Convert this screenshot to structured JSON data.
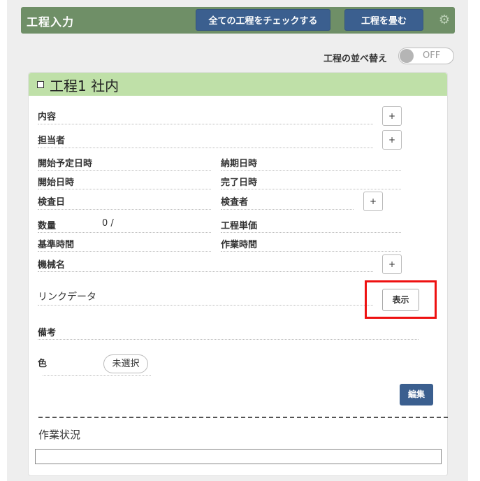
{
  "header": {
    "title": "工程入力",
    "check_all_label": "全ての工程をチェックする",
    "fold_label": "工程を畳む",
    "settings_icon": "gear-icon"
  },
  "sort": {
    "label": "工程の並べ替え",
    "toggle_state": "OFF"
  },
  "card": {
    "title": "工程1 社内",
    "fields": {
      "content": "内容",
      "assignee": "担当者",
      "planned_start": "開始予定日時",
      "due_date": "納期日時",
      "start_date": "開始日時",
      "finish_date": "完了日時",
      "inspection_date": "検査日",
      "inspector": "検査者",
      "quantity": "数量",
      "quantity_value": "0 /",
      "unit_price": "工程単価",
      "standard_time": "基準時間",
      "work_time": "作業時間",
      "machine": "機械名",
      "link_data": "リンクデータ",
      "notes": "備考",
      "color": "色"
    },
    "plus_label": "+",
    "show_label": "表示",
    "color_value": "未選択",
    "edit_label": "編集",
    "status_label": "作業状況"
  }
}
